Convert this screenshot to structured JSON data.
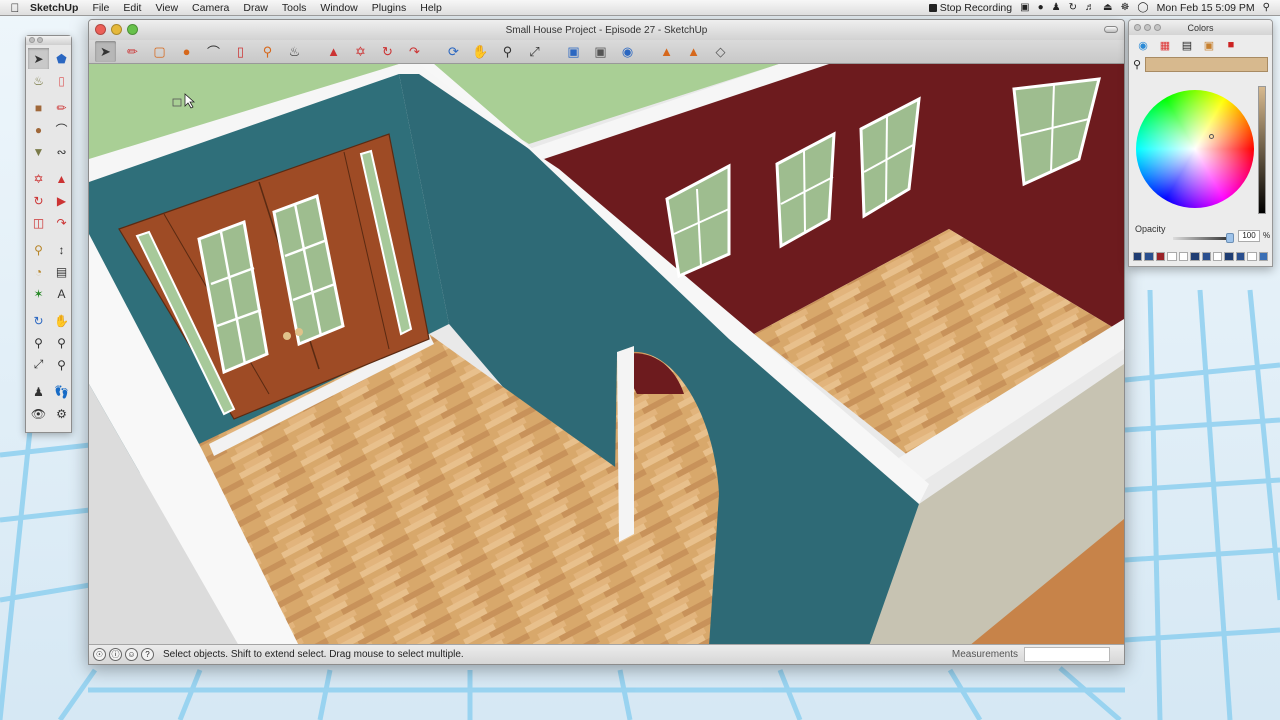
{
  "menubar": {
    "app_name": "SketchUp",
    "menus": [
      "File",
      "Edit",
      "View",
      "Camera",
      "Draw",
      "Tools",
      "Window",
      "Plugins",
      "Help"
    ],
    "stop_recording": "Stop Recording",
    "clock": "Mon Feb 15  5:09 PM"
  },
  "window": {
    "title": "Small House Project - Episode 27 - SketchUp"
  },
  "status": {
    "hint": "Select objects. Shift to extend select. Drag mouse to select multiple.",
    "measurements_label": "Measurements",
    "measurements_value": ""
  },
  "colors_panel": {
    "title": "Colors",
    "opacity_label": "Opacity",
    "opacity_value": "100",
    "opacity_unit": "%",
    "current_color": "#d7b98e"
  },
  "icons": {
    "toolbar": [
      "select-icon",
      "pencil-icon",
      "rectangle-icon",
      "circle-icon",
      "arc-icon",
      "eraser-icon",
      "tape-measure-icon",
      "paint-bucket-icon",
      "push-pull-icon",
      "move-icon",
      "rotate-icon",
      "follow-me-icon",
      "orbit-icon",
      "pan-icon",
      "zoom-icon",
      "zoom-extents-icon",
      "previous-view-icon",
      "next-view-icon",
      "warehouse-icon",
      "share-model-icon",
      "component-icon",
      "extension-icon"
    ],
    "palette": [
      "select-icon",
      "eraser-icon",
      "paint-bucket-icon",
      "eraser-icon",
      "rectangle-icon",
      "line-icon",
      "circle-icon",
      "arc-icon",
      "polygon-icon",
      "freehand-icon",
      "move-icon",
      "push-pull-icon",
      "rotate-icon",
      "follow-me-icon",
      "scale-icon",
      "offset-icon",
      "tape-measure-icon",
      "dimension-icon",
      "protractor-icon",
      "text-icon",
      "axes-icon",
      "3d-text-icon",
      "orbit-icon",
      "pan-icon",
      "zoom-icon",
      "zoom-window-icon",
      "zoom-extents-icon",
      "previous-icon",
      "position-camera-icon",
      "walk-icon",
      "look-around-icon",
      "section-plane-icon"
    ]
  }
}
